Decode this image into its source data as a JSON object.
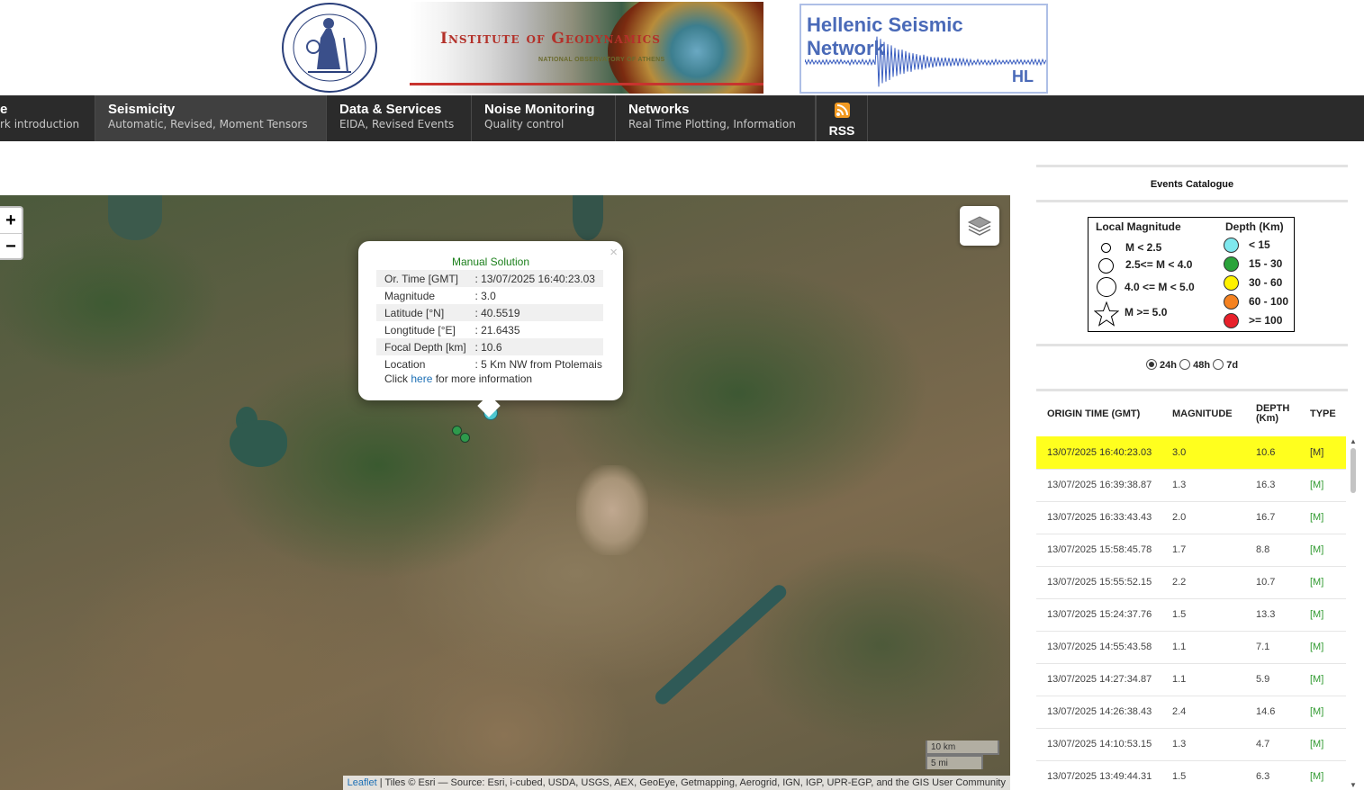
{
  "header": {
    "ig_title": "Institute of Geodynamics",
    "ig_subtitle": "NATIONAL OBSERVATORY OF ATHENS",
    "hsn_title": "Hellenic Seismic Network",
    "hsn_code": "HL"
  },
  "nav": [
    {
      "title": "e",
      "sub": "rk introduction"
    },
    {
      "title": "Seismicity",
      "sub": "Automatic, Revised, Moment Tensors"
    },
    {
      "title": "Data & Services",
      "sub": "EIDA, Revised Events"
    },
    {
      "title": "Noise Monitoring",
      "sub": "Quality control"
    },
    {
      "title": "Networks",
      "sub": "Real Time Plotting, Information"
    }
  ],
  "rss_label": "RSS",
  "colors": {
    "accent_nav": "#2b2b2b",
    "selected_row": "#ffff1e",
    "type_text": "#2f9a2f"
  },
  "map": {
    "zoom_in": "+",
    "zoom_out": "−",
    "scale_km": "10 km",
    "scale_mi": "5 mi",
    "attribution_link": "Leaflet",
    "attribution_text": " | Tiles © Esri — Source: Esri, i-cubed, USDA, USGS, AEX, GeoEye, Getmapping, Aerogrid, IGN, IGP, UPR-EGP, and the GIS User Community",
    "popup": {
      "close": "×",
      "heading": "Manual Solution",
      "rows": [
        {
          "label": "Or. Time [GMT]",
          "value": ": 13/07/2025 16:40:23.03"
        },
        {
          "label": "Magnitude",
          "value": ": 3.0"
        },
        {
          "label": "Latitude [°N]",
          "value": ": 40.5519"
        },
        {
          "label": "Longtitude [°E]",
          "value": ": 21.6435"
        },
        {
          "label": "Focal Depth [km]",
          "value": ": 10.6"
        },
        {
          "label": "Location",
          "value": ": 5 Km NW from Ptolemais"
        }
      ],
      "foot_pre": "Click ",
      "foot_link": "here",
      "foot_post": " for more information"
    }
  },
  "panel": {
    "title": "Events Catalogue",
    "legend": {
      "mag_header": "Local Magnitude",
      "depth_header": "Depth (Km)",
      "magnitudes": [
        "M < 2.5",
        "2.5<= M < 4.0",
        "4.0 <= M < 5.0",
        "M >= 5.0"
      ],
      "depths": [
        {
          "label": "< 15",
          "color": "#7fe8ee"
        },
        {
          "label": "15 - 30",
          "color": "#2aa33a"
        },
        {
          "label": "30 - 60",
          "color": "#fff200"
        },
        {
          "label": "60 - 100",
          "color": "#f58220"
        },
        {
          "label": ">= 100",
          "color": "#e8202a"
        }
      ]
    },
    "periods": [
      "24h",
      "48h",
      "7d"
    ],
    "selected_period": "24h",
    "columns": [
      "ORIGIN TIME (GMT)",
      "MAGNITUDE",
      "DEPTH (Km)",
      "TYPE"
    ],
    "events": [
      {
        "time": "13/07/2025 16:40:23.03",
        "mag": "3.0",
        "depth": "10.6",
        "type": "[M]"
      },
      {
        "time": "13/07/2025 16:39:38.87",
        "mag": "1.3",
        "depth": "16.3",
        "type": "[M]"
      },
      {
        "time": "13/07/2025 16:33:43.43",
        "mag": "2.0",
        "depth": "16.7",
        "type": "[M]"
      },
      {
        "time": "13/07/2025 15:58:45.78",
        "mag": "1.7",
        "depth": "8.8",
        "type": "[M]"
      },
      {
        "time": "13/07/2025 15:55:52.15",
        "mag": "2.2",
        "depth": "10.7",
        "type": "[M]"
      },
      {
        "time": "13/07/2025 15:24:37.76",
        "mag": "1.5",
        "depth": "13.3",
        "type": "[M]"
      },
      {
        "time": "13/07/2025 14:55:43.58",
        "mag": "1.1",
        "depth": "7.1",
        "type": "[M]"
      },
      {
        "time": "13/07/2025 14:27:34.87",
        "mag": "1.1",
        "depth": "5.9",
        "type": "[M]"
      },
      {
        "time": "13/07/2025 14:26:38.43",
        "mag": "2.4",
        "depth": "14.6",
        "type": "[M]"
      },
      {
        "time": "13/07/2025 14:10:53.15",
        "mag": "1.3",
        "depth": "4.7",
        "type": "[M]"
      },
      {
        "time": "13/07/2025 13:49:44.31",
        "mag": "1.5",
        "depth": "6.3",
        "type": "[M]"
      }
    ]
  }
}
